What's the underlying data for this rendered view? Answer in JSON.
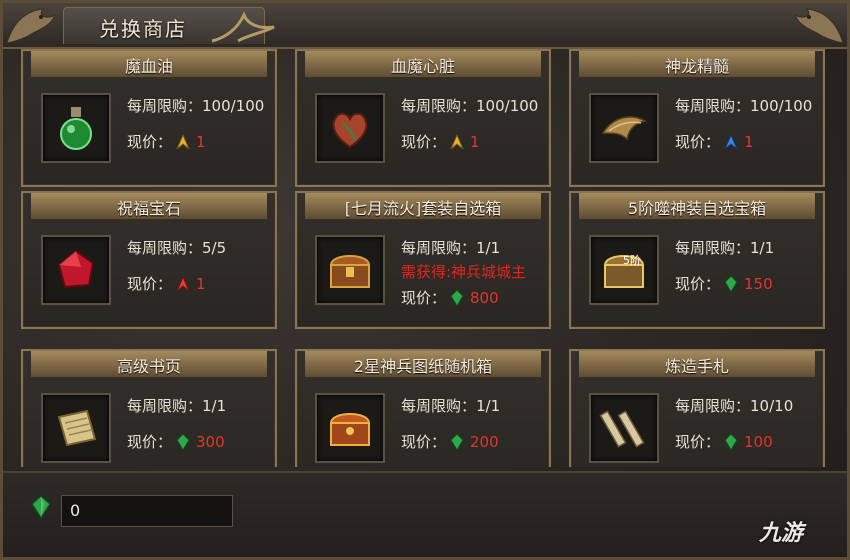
{
  "window": {
    "title": "兑换商店"
  },
  "labels": {
    "weekly_limit_prefix": "每周限购：",
    "price_prefix": "现价："
  },
  "items": [
    {
      "name": "魔血油",
      "limit": "100/100",
      "price": "1",
      "currency": "gold-feather-icon",
      "icon": "green-potion-icon"
    },
    {
      "name": "血魔心脏",
      "limit": "100/100",
      "price": "1",
      "currency": "gold-feather-icon",
      "icon": "demon-heart-icon"
    },
    {
      "name": "神龙精髓",
      "limit": "100/100",
      "price": "1",
      "currency": "blue-feather-icon",
      "icon": "dragon-essence-icon"
    },
    {
      "name": "祝福宝石",
      "limit": "5/5",
      "price": "1",
      "currency": "red-feather-icon",
      "icon": "red-gem-icon"
    },
    {
      "name": "[七月流火]套装自选箱",
      "limit": "1/1",
      "requirement": "需获得:神兵城城主",
      "price": "800",
      "currency": "green-crystal-icon",
      "icon": "treasure-chest-icon"
    },
    {
      "name": "5阶噬神装自选宝箱",
      "limit": "1/1",
      "price": "150",
      "currency": "green-crystal-icon",
      "icon": "tier5-chest-icon",
      "icon_text": "5阶"
    },
    {
      "name": "高级书页",
      "limit": "1/1",
      "price": "300",
      "currency": "green-crystal-icon",
      "icon": "scroll-page-icon"
    },
    {
      "name": "2星神兵图纸随机箱",
      "limit": "1/1",
      "price": "200",
      "currency": "green-crystal-icon",
      "icon": "blueprint-chest-icon"
    },
    {
      "name": "炼造手札",
      "limit": "10/10",
      "price": "100",
      "currency": "green-crystal-icon",
      "icon": "forging-notes-icon"
    }
  ],
  "currency_balance": {
    "value": "0",
    "icon": "green-crystal-icon"
  },
  "watermark": "九游",
  "colors": {
    "price": "#e8332a",
    "requirement": "#e0261e",
    "frame": "#8a7452"
  }
}
